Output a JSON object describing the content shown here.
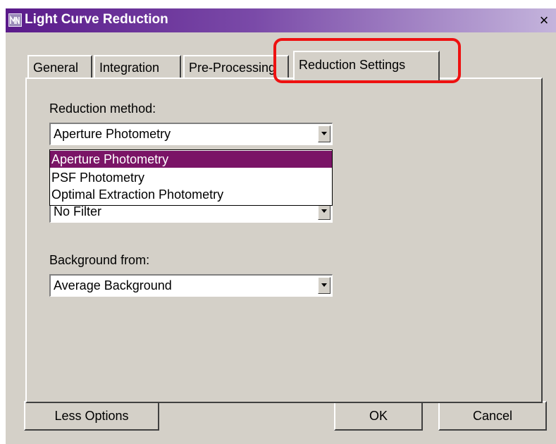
{
  "window": {
    "title": "Light Curve Reduction",
    "close_label": "×",
    "colors": {
      "titlebar_start": "#5a1a8a",
      "titlebar_end": "#c4b4dc",
      "highlight": "#ee1111",
      "selection": "#7a1466"
    }
  },
  "tabs": [
    {
      "label": "General",
      "active": false
    },
    {
      "label": "Integration",
      "active": false
    },
    {
      "label": "Pre-Processing",
      "active": false
    },
    {
      "label": "Reduction Settings",
      "active": true
    }
  ],
  "reduction_method": {
    "label": "Reduction method:",
    "value": "Aperture Photometry",
    "options": [
      "Aperture Photometry",
      "PSF Photometry",
      "Optimal Extraction Photometry"
    ],
    "selected_index": 0
  },
  "filter": {
    "value": "No Filter"
  },
  "background": {
    "label": "Background from:",
    "value": "Average Background"
  },
  "buttons": {
    "less_options": "Less Options",
    "ok": "OK",
    "cancel": "Cancel"
  }
}
